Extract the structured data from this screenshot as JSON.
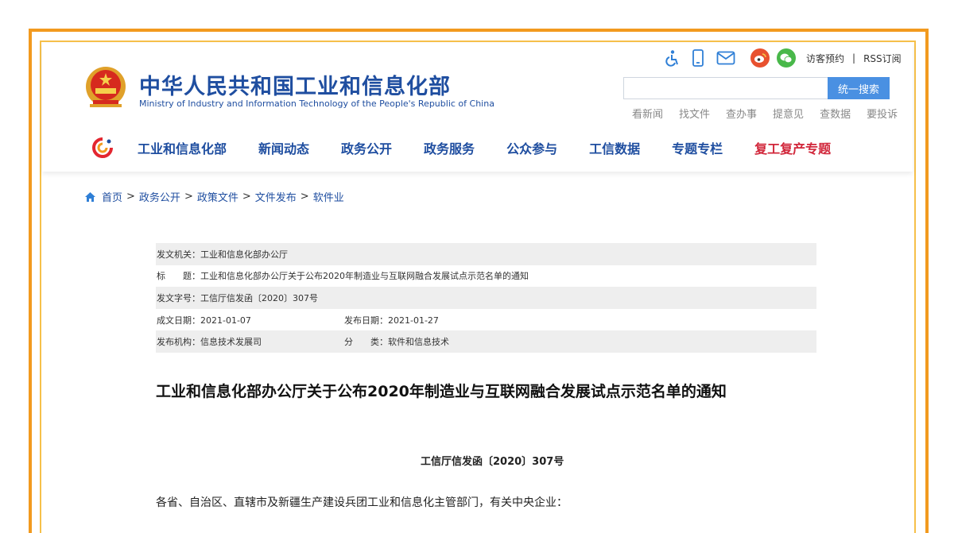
{
  "header": {
    "title": "中华人民共和国工业和信息化部",
    "subtitle": "Ministry of Industry and Information Technology of the People's Republic of China",
    "top_links": {
      "visitor": "访客预约",
      "separator": "|",
      "rss": "RSS订阅"
    },
    "top_icons": [
      "accessibility-icon",
      "mobile-icon",
      "mail-icon",
      "weibo-icon",
      "wechat-icon"
    ],
    "search": {
      "placeholder": "",
      "button": "统一搜索"
    },
    "quick_links": [
      "看新闻",
      "找文件",
      "查办事",
      "提意见",
      "查数据",
      "要投诉"
    ]
  },
  "nav": {
    "items": [
      {
        "label": "工业和信息化部"
      },
      {
        "label": "新闻动态"
      },
      {
        "label": "政务公开"
      },
      {
        "label": "政务服务"
      },
      {
        "label": "公众参与"
      },
      {
        "label": "工信数据"
      },
      {
        "label": "专题专栏"
      },
      {
        "label": "复工复产专题"
      }
    ]
  },
  "breadcrumb": [
    "首页",
    "政务公开",
    "政策文件",
    "文件发布",
    "软件业"
  ],
  "breadcrumb_sep": ">",
  "meta": {
    "issuer": "发文机关：工业和信息化部办公厅",
    "title": "标　　题：工业和信息化部办公厅关于公布2020年制造业与互联网融合发展试点示范名单的通知",
    "doc_no": "发文字号：工信厅信发函〔2020〕307号",
    "created": "成文日期：2021-01-07",
    "published": "发布日期：2021-01-27",
    "org": "发布机构：信息技术发展司",
    "category": "分　　类：软件和信息技术"
  },
  "document": {
    "title": "工业和信息化部办公厅关于公布2020年制造业与互联网融合发展试点示范名单的通知",
    "number": "工信厅信发函〔2020〕307号",
    "salutation": "各省、自治区、直辖市及新疆生产建设兵团工业和信息化主管部门，有关中央企业："
  },
  "colors": {
    "frame_outer": "#f29a1f",
    "frame_inner": "#f6c04a",
    "brand_blue": "#1f4ea0",
    "accent_red": "#d1263a",
    "search_button": "#4a90e2"
  }
}
